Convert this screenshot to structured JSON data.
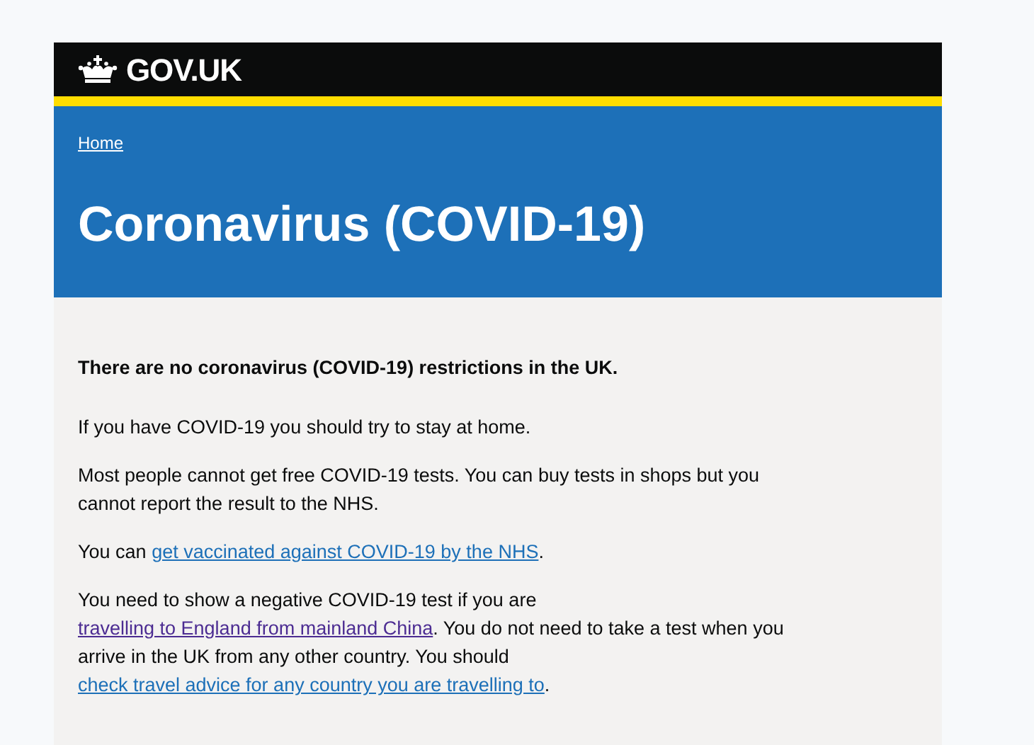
{
  "header": {
    "logo_text": "GOV.UK"
  },
  "breadcrumb": {
    "label": "Home"
  },
  "title": "Coronavirus (COVID-19)",
  "body": [
    {
      "kind": "lead",
      "parts": [
        {
          "kind": "text",
          "text": "There are no coronavirus (COVID-19) restrictions in the UK."
        }
      ]
    },
    {
      "kind": "para",
      "parts": [
        {
          "kind": "text",
          "text": "If you have COVID-19 you should try to stay at home."
        }
      ]
    },
    {
      "kind": "para",
      "parts": [
        {
          "kind": "text",
          "text": "Most people cannot get free COVID-19 tests. You can buy tests in shops but you cannot report the result to the NHS."
        }
      ]
    },
    {
      "kind": "para",
      "parts": [
        {
          "kind": "text",
          "text": "You can "
        },
        {
          "kind": "link",
          "text": "get vaccinated against COVID-19 by the NHS",
          "visited": false
        },
        {
          "kind": "text",
          "text": "."
        }
      ]
    },
    {
      "kind": "para",
      "parts": [
        {
          "kind": "text",
          "text": "You need to show a negative COVID-19 test if you are "
        },
        {
          "kind": "link",
          "text": "travelling to England from mainland China",
          "visited": true
        },
        {
          "kind": "text",
          "text": ". You do not need to take a test when you arrive in the UK from any other country. You should "
        },
        {
          "kind": "link",
          "text": "check travel advice for any country you are travelling to",
          "visited": false
        },
        {
          "kind": "text",
          "text": "."
        }
      ]
    }
  ]
}
